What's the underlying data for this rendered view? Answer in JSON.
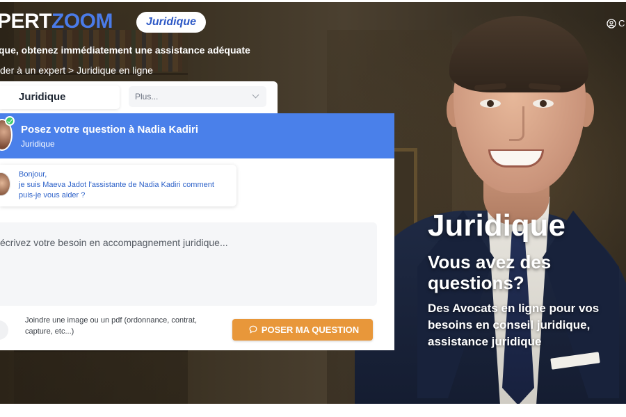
{
  "header": {
    "logo_part1": "PERT",
    "logo_part2": "ZOOM",
    "category_pill": "Juridique",
    "account_label": "C"
  },
  "intro": {
    "tagline": "que, obtenez immédiatement une assistance adéquate",
    "breadcrumb": "der à un expert > Juridique en ligne"
  },
  "tabs": {
    "active": "Juridique",
    "more_placeholder": "Plus..."
  },
  "chat": {
    "title": "Posez votre question à Nadia Kadiri",
    "subtitle": "Juridique",
    "message_lines": [
      "Bonjour,",
      "je suis Maeva Jadot l'assistante de Nadia Kadiri comment",
      "puis-je vous aider ?"
    ],
    "input_placeholder": "écrivez votre besoin en accompagnement juridique...",
    "attach_lines": [
      "Joindre une image ou un pdf (ordonnance, contrat,",
      "capture, etc...)"
    ],
    "submit_label": "POSER MA QUESTION"
  },
  "hero": {
    "title": "Juridique",
    "question_line1": "Vous avez des",
    "question_line2": "questions?",
    "description_lines": [
      "Des Avocats en ligne pour vos",
      "besoins en conseil juridique,",
      "assistance juridique"
    ]
  },
  "colors": {
    "brand_blue": "#4a7be8",
    "header_blue": "#4a80ea",
    "cta_orange": "#e8973a",
    "online_green": "#3ecb6b"
  },
  "icons": {
    "account": "user-circle-icon",
    "chevron": "chevron-down-icon",
    "chat": "chat-bubble-icon",
    "online": "check-circle-icon"
  }
}
